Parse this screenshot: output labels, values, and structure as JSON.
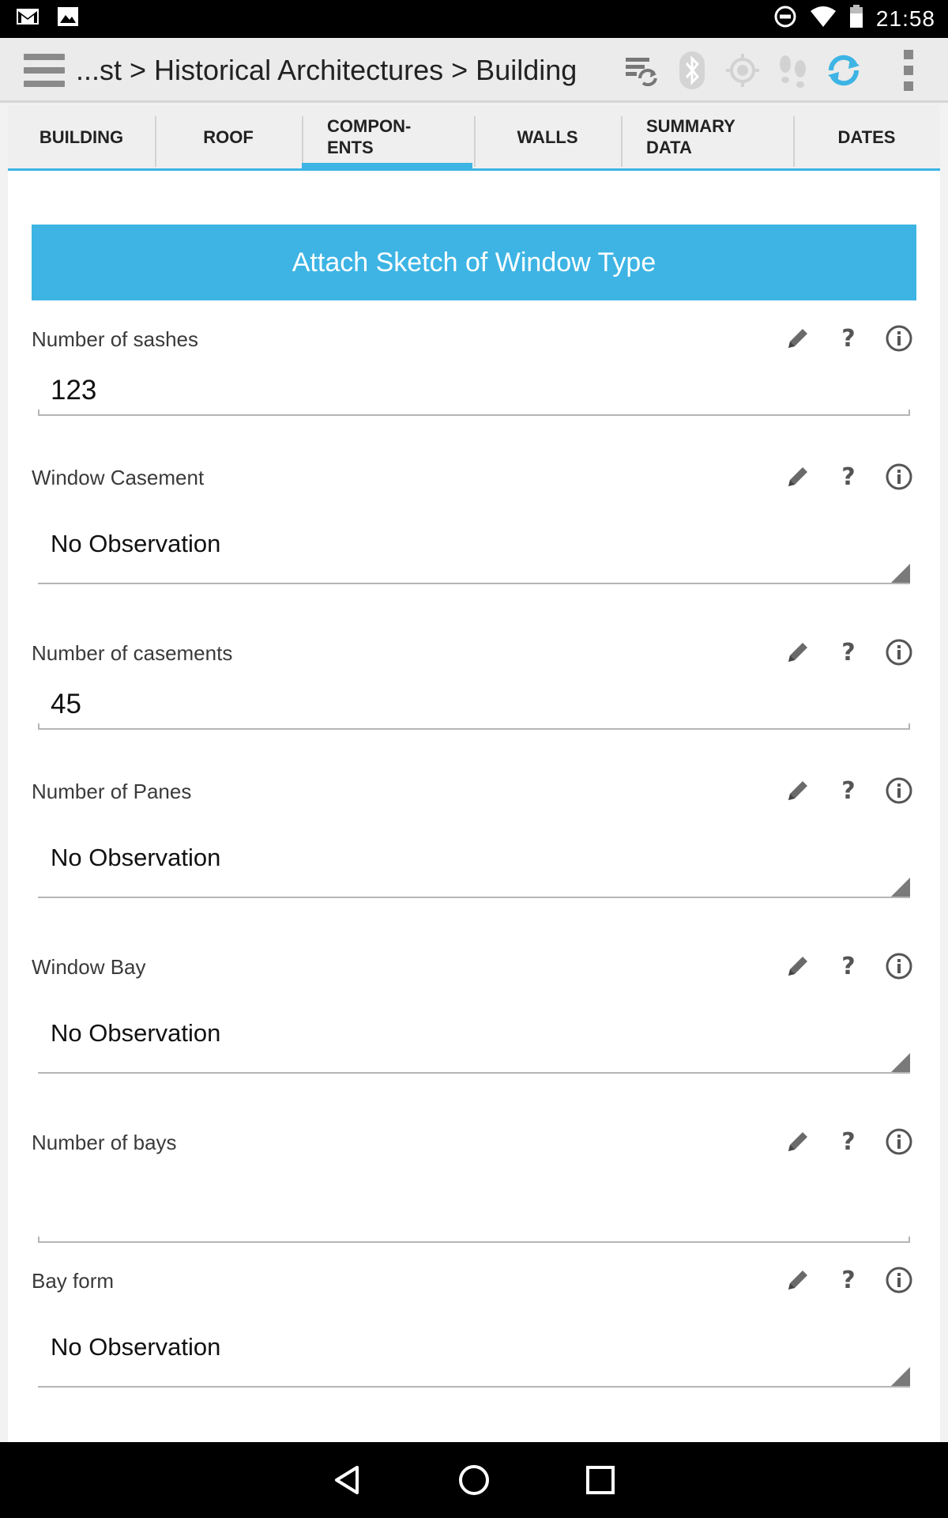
{
  "status_bar": {
    "time": "21:58",
    "icons": [
      "gmail-icon",
      "gallery-icon",
      "do-not-disturb-icon",
      "wifi-icon",
      "battery-icon"
    ]
  },
  "action_bar": {
    "breadcrumb": "...st > Historical Architectures > Building",
    "icons": [
      "menu-icon",
      "sync-list-icon",
      "bluetooth-icon",
      "gps-icon",
      "tracker-icon",
      "refresh-icon",
      "overflow-icon"
    ]
  },
  "tabs": [
    {
      "label": "BUILDING"
    },
    {
      "label": "ROOF"
    },
    {
      "label": "COMPON-\nENTS"
    },
    {
      "label": "WALLS"
    },
    {
      "label": "SUMMARY\nDATA"
    },
    {
      "label": "DATES"
    }
  ],
  "attach_button": "Attach Sketch of Window Type",
  "fields": [
    {
      "label": "Number of sashes",
      "type": "text",
      "value": "123"
    },
    {
      "label": "Window Casement",
      "type": "select",
      "value": "No Observation"
    },
    {
      "label": "Number of casements",
      "type": "text",
      "value": "45"
    },
    {
      "label": "Number of Panes",
      "type": "select",
      "value": "No Observation"
    },
    {
      "label": "Window Bay",
      "type": "select",
      "value": "No Observation"
    },
    {
      "label": "Number of bays",
      "type": "text",
      "value": ""
    },
    {
      "label": "Bay form",
      "type": "select",
      "value": "No Observation"
    }
  ],
  "field_action_icons": [
    "pencil-icon",
    "question-icon",
    "info-icon"
  ],
  "colors": {
    "accent": "#3db4e4",
    "action_bar": "#ebebeb",
    "refresh_icon": "#3db4e4"
  }
}
